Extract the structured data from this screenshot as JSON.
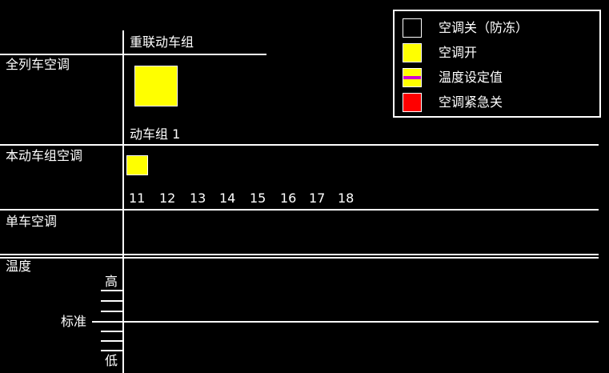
{
  "legend": {
    "items": [
      {
        "label": "空调关（防冻）",
        "color": "#000000"
      },
      {
        "label": "空调开",
        "color": "#ffff00"
      },
      {
        "label": "温度设定值",
        "color": "#ffff00",
        "stripe": "#d000d0"
      },
      {
        "label": "空调紧急关",
        "color": "#ff0000"
      }
    ]
  },
  "header": {
    "title": "重联动车组"
  },
  "sections": {
    "all_train": {
      "label": "全列车空调",
      "unit_label": "动车组 1"
    },
    "this_unit": {
      "label": "本动车组空调",
      "cars": [
        "11",
        "12",
        "13",
        "14",
        "15",
        "16",
        "17",
        "18"
      ]
    },
    "single_car": {
      "label": "单车空调"
    },
    "temperature": {
      "label": "温度",
      "high": "高",
      "standard": "标准",
      "low": "低"
    }
  },
  "colors": {
    "background": "#000000",
    "foreground": "#ffffff",
    "on": "#ffff00",
    "emergency": "#ff0000",
    "setpoint": "#d000d0"
  }
}
